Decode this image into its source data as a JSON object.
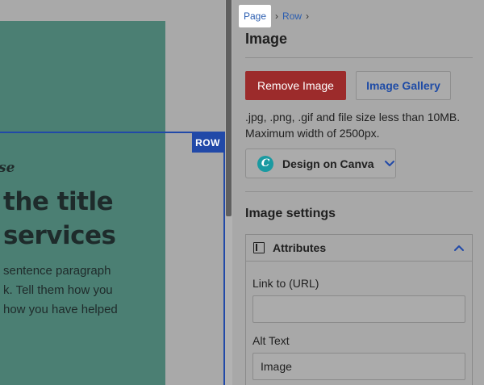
{
  "canvas": {
    "row_badge": "ROW",
    "eyebrow": "se",
    "headline_lines": [
      "the title",
      "services"
    ],
    "paragraph_lines": [
      "sentence paragraph",
      "k. Tell them how you",
      "how you have helped"
    ]
  },
  "panel": {
    "breadcrumb": {
      "page": "Page",
      "row": "Row",
      "separator": "›"
    },
    "section_title": "Image",
    "remove_button": "Remove Image",
    "gallery_button": "Image Gallery",
    "hint_lines": [
      ".jpg, .png, .gif and file size less than 10MB.",
      "Maximum width of 2500px."
    ],
    "canva_button": {
      "logo": "C",
      "label": "Design on Canva",
      "icon": "chevron-down-icon"
    },
    "image_settings_title": "Image settings",
    "attributes": {
      "label": "Attributes",
      "icon": "sidebar-layout-icon",
      "link_label": "Link to (URL)",
      "link_value": "",
      "alt_label": "Alt Text",
      "alt_value": "Image"
    }
  },
  "colors": {
    "accent": "#2149a8",
    "danger": "#9c2b2b",
    "teal_block": "#4b7f73",
    "canva_logo": "#1a9aa1"
  }
}
